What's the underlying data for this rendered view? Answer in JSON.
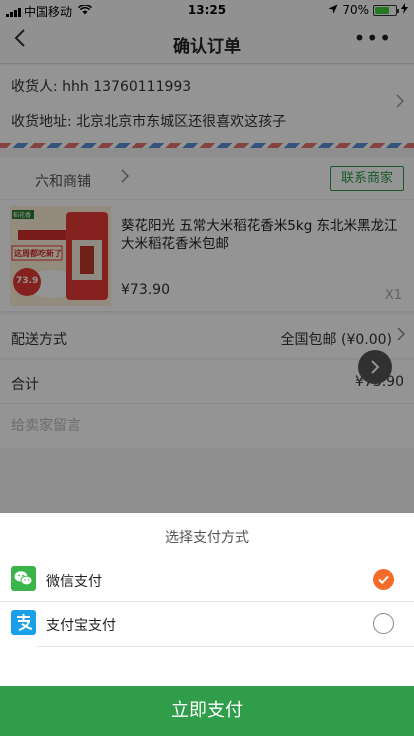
{
  "status_bar": {
    "carrier": "中国移动",
    "time": "13:25",
    "battery": "70%",
    "battery_level": 0.7
  },
  "nav": {
    "title": "确认订单",
    "back_icon": "chevron-left-icon",
    "more_label": "•••"
  },
  "address": {
    "recipient": "收货人: hhh  13760111993",
    "address": "收货地址: 北京北京市东城区还很喜欢这孩子"
  },
  "shop": {
    "name": "六和商铺",
    "contact_label": "联系商家"
  },
  "product": {
    "name": "葵花阳光 五常大米稻花香米5kg 东北米黑龙江大米稻花香米包邮",
    "price": "¥73.90",
    "quantity": "X1",
    "image_texts": {
      "badge": "稻花香",
      "banner": "这周都吃新了",
      "price_tag": "73.9"
    }
  },
  "delivery": {
    "label": "配送方式",
    "value": "全国包邮 (¥0.00)"
  },
  "total": {
    "label": "合计",
    "value": "¥73.90"
  },
  "remark": {
    "placeholder": "给卖家留言"
  },
  "payment_sheet": {
    "title": "选择支付方式",
    "options": [
      {
        "label": "微信支付",
        "icon": "wechat-icon",
        "selected": true
      },
      {
        "label": "支付宝支付",
        "icon": "alipay-icon",
        "selected": false
      }
    ],
    "pay_button": "立即支付"
  },
  "colors": {
    "brand_green": "#2f9d4a",
    "selected_orange": "#f56c2a",
    "wechat_green": "#3bb44a",
    "alipay_blue": "#1aa0e8"
  }
}
